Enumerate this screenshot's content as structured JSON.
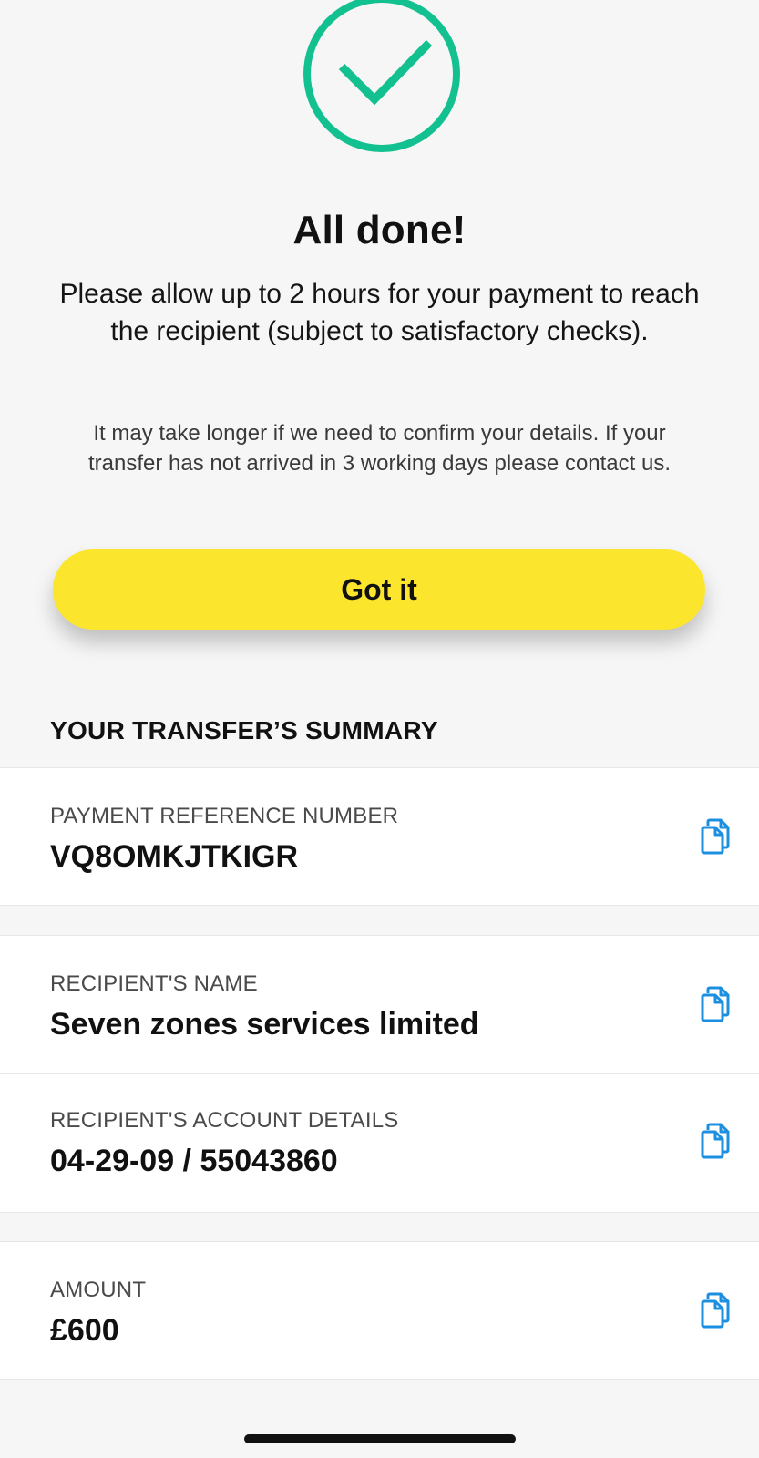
{
  "confirmation": {
    "title": "All done!",
    "lead": "Please allow up to 2 hours for your payment to reach the recipient (subject to satisfactory checks).",
    "note": "It may take longer if we need to confirm your details. If your transfer has not arrived in 3 working days please contact us.",
    "button_label": "Got it",
    "icon": "check-circle-icon"
  },
  "summary": {
    "heading": "YOUR TRANSFER’S SUMMARY",
    "reference": {
      "label": "PAYMENT REFERENCE NUMBER",
      "value": "VQ8OMKJTKIGR",
      "icon": "copy-icon"
    },
    "recipient_name": {
      "label": "RECIPIENT'S NAME",
      "value": "Seven zones services limited",
      "icon": "copy-icon"
    },
    "account_details": {
      "label": "RECIPIENT'S ACCOUNT DETAILS",
      "value": "04-29-09 / 55043860",
      "icon": "copy-icon"
    },
    "amount": {
      "label": "AMOUNT",
      "value": "£600",
      "icon": "copy-icon"
    }
  },
  "colors": {
    "background": "#f6f6f6",
    "success": "#13c08f",
    "button": "#fbe62d",
    "copy_icon": "#1c8fe0",
    "card": "#ffffff"
  }
}
